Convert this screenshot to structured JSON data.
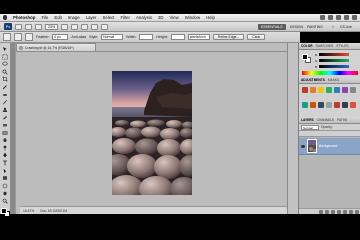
{
  "menubar": {
    "app_name": "Photoshop",
    "items": [
      "File",
      "Edit",
      "Image",
      "Layer",
      "Select",
      "Filter",
      "Analysis",
      "3D",
      "View",
      "Window",
      "Help"
    ]
  },
  "appbar": {
    "logo": "Ps",
    "zoom": "25%",
    "workspace_active": "ESSENTIALS",
    "workspace_design": "DESIGN",
    "workspace_painting": "PAINTING",
    "more": "»",
    "cs_live": "CS Live"
  },
  "options": {
    "feather_label": "Feather:",
    "feather_value": "0 px",
    "antialias_label": "Anti-alias",
    "style_label": "Style:",
    "style_value": "Normal",
    "width_label": "Width:",
    "height_label": "Height:",
    "resolution_value": "pixels/inch",
    "refine_edge": "Refine Edge...",
    "clear": "Clear"
  },
  "document": {
    "tab_title": "Crashing.tif @ 16.7% (RGB/16*)",
    "status_zoom": "16.67%",
    "status_doc": "Doc: 69.1M/69.1M"
  },
  "color_panel": {
    "tabs": [
      "COLOR",
      "SWATCHES",
      "STYLES"
    ],
    "sliders": [
      {
        "letter": "R",
        "color": "#e74c3c"
      },
      {
        "letter": "G",
        "color": "#27ae60"
      },
      {
        "letter": "B",
        "color": "#2e6fd1"
      }
    ]
  },
  "adjust_panel": {
    "tabs": [
      "ADJUSTMENTS",
      "MASKS"
    ],
    "icon_colors": [
      "#c0392b",
      "#e67e22",
      "#f1c40f",
      "#27ae60",
      "#2980b9",
      "#8e44ad",
      "#7f8c8d",
      "#16a085",
      "#d35400",
      "#34495e",
      "#95a5a6",
      "#c0392b",
      "#2c3e50",
      "#e74c3c"
    ]
  },
  "layers_panel": {
    "tabs": [
      "LAYERS",
      "CHANNELS",
      "PATHS"
    ],
    "blend_mode": "Normal",
    "opacity": "Opacity:",
    "layer_name": "Background"
  }
}
